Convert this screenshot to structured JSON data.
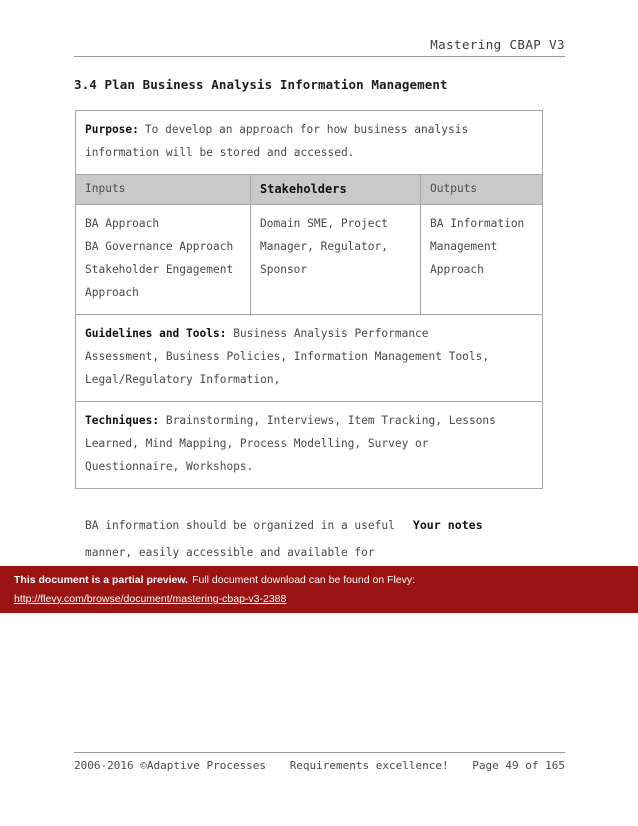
{
  "header": {
    "title": "Mastering CBAP V3"
  },
  "section": {
    "heading": "3.4 Plan Business Analysis Information Management"
  },
  "table": {
    "purpose_label": "Purpose:",
    "purpose_text_line1": "To develop an approach for how business analysis",
    "purpose_text_line2": "information will be stored and accessed.",
    "columns": {
      "inputs": "Inputs",
      "stakeholders": "Stakeholders",
      "outputs": "Outputs"
    },
    "inputs": [
      "BA Approach",
      "BA Governance Approach",
      "Stakeholder Engagement",
      "Approach"
    ],
    "stakeholders": [
      "Domain SME, Project",
      "Manager, Regulator,",
      "Sponsor"
    ],
    "outputs": [
      "BA Information",
      "Management",
      "Approach"
    ],
    "guidelines_label": "Guidelines and Tools:",
    "guidelines": [
      "Business Analysis Performance",
      "Assessment, Business Policies, Information Management Tools,",
      "Legal/Regulatory Information,"
    ],
    "techniques_label": "Techniques:",
    "techniques": [
      "Brainstorming, Interviews, Item Tracking, Lessons",
      "Learned, Mind Mapping, Process Modelling, Survey or",
      "Questionnaire, Workshops."
    ]
  },
  "body": {
    "line1": "BA information should be organized in a useful",
    "line2": "manner, easily accessible and available for",
    "notes_label": "Your notes"
  },
  "banner": {
    "strong": "This document is a partial preview.",
    "rest": "Full document download can be found on Flevy:",
    "url": "http://flevy.com/browse/document/mastering-cbap-v3-2388",
    "background_color": "#9b1313"
  },
  "footer": {
    "copyright": "2006-2016 ©Adaptive Processes",
    "tagline": "Requirements excellence!",
    "page": "Page 49 of 165"
  }
}
